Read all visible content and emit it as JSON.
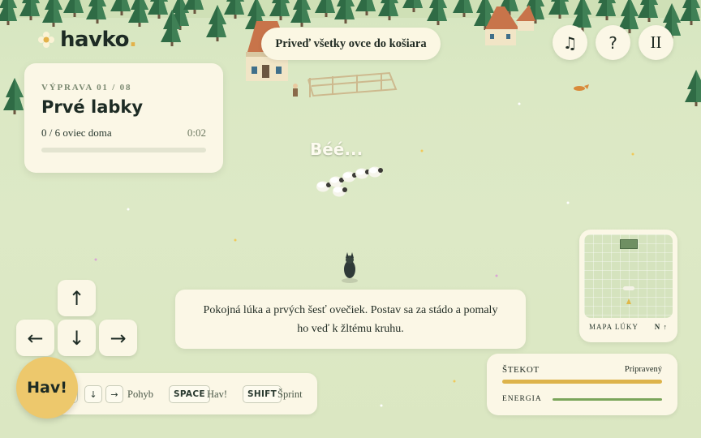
{
  "app": {
    "logo": "havko",
    "logo_dot": "."
  },
  "objective": "Priveď všetky ovce do košiara",
  "top_buttons": {
    "music_icon": "♫",
    "help_label": "?",
    "pause_label": "II"
  },
  "level": {
    "label": "VÝPRAVA 01 / 08",
    "title": "Prvé labky",
    "sheep_home": "0 / 6 oviec doma",
    "timer": "0:02",
    "progress": 0
  },
  "bubble": "Béé...",
  "dialog": "Pokojná lúka a prvých šesť ovečiek. Postav sa za stádo a pomaly ho veď k žltému kruhu.",
  "dpad": {
    "up": "↑",
    "left": "←",
    "down": "↓",
    "right": "→"
  },
  "controls": {
    "down_key": "↓",
    "right_key": "→",
    "move_label": "Pohyb",
    "space_key": "SPACE",
    "bark_label": "Hav!",
    "shift_key": "SHIFT",
    "sprint_label": "Šprint"
  },
  "bark_button": "Hav!",
  "minimap": {
    "label": "MAPA LÚKY",
    "north": "N ↑"
  },
  "status": {
    "bark_label": "ŠTEKOT",
    "bark_state": "Pripravený",
    "bark_level": 1.0,
    "energy_label": "ENERGIA",
    "energy_level": 1.0
  },
  "colors": {
    "accent": "#e3b24a",
    "panel": "#fbf7e6",
    "meadow": "#dbe7c2",
    "energy": "#7aa55a"
  }
}
